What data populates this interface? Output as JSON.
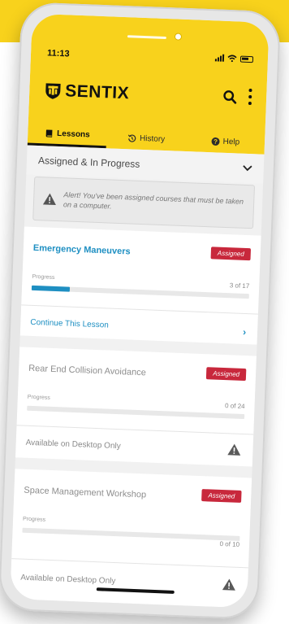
{
  "status": {
    "time": "11:13"
  },
  "brand": {
    "name": "SENTIX",
    "accent": "#f8d21c",
    "link_color": "#1e8fc2",
    "badge_color": "#c8283c"
  },
  "tabs": [
    {
      "label": "Lessons",
      "icon": "book-icon",
      "active": true
    },
    {
      "label": "History",
      "icon": "history-icon",
      "active": false
    },
    {
      "label": "Help",
      "icon": "help-icon",
      "active": false
    }
  ],
  "section": {
    "title": "Assigned & In Progress"
  },
  "alert": {
    "text": "Alert! You've been assigned courses that must be taken on a computer."
  },
  "lessons": [
    {
      "title": "Emergency Maneuvers",
      "badge": "Assigned",
      "progress_label": "Progress",
      "progress_text": "3 of 17",
      "progress": 0.176,
      "action": "Continue This Lesson"
    },
    {
      "title": "Rear End Collision Avoidance",
      "badge": "Assigned",
      "progress_label": "Progress",
      "progress_text": "0 of 24",
      "progress": 0,
      "action": "Available on Desktop Only"
    },
    {
      "title": "Space Management Workshop",
      "badge": "Assigned",
      "progress_label": "Progress",
      "progress_text": "0 of 10",
      "progress": 0,
      "action": "Available on Desktop Only"
    }
  ]
}
